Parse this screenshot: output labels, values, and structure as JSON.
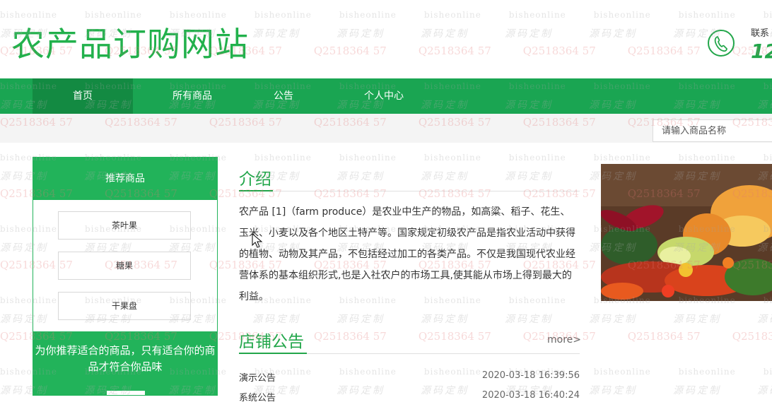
{
  "header": {
    "site_title": "农产品订购网站",
    "contact_label": "联系",
    "contact_number": "12"
  },
  "nav": {
    "items": [
      {
        "label": "首页",
        "active": true
      },
      {
        "label": "所有商品",
        "active": false
      },
      {
        "label": "公告",
        "active": false
      },
      {
        "label": "个人中心",
        "active": false
      }
    ]
  },
  "search": {
    "placeholder": "请输入商品名称"
  },
  "sidebar": {
    "title": "推荐商品",
    "items": [
      "茶叶果",
      "糖果",
      "干果盘"
    ],
    "footer_text": "为你推荐适合的商品，只有适合你的商品才符合你品味"
  },
  "intro": {
    "title": "介绍",
    "text": "农产品 [1]（farm produce）是农业中生产的物品，如高粱、稻子、花生、玉米、小麦以及各个地区土特产等。国家规定初级农产品是指农业活动中获得的植物、动物及其产品，不包括经过加工的各类产品。不仅是我国现代农业经营体系的基本组织形式,也是入社农户的市场工具,使其能从市场上得到最大的利益。"
  },
  "notices": {
    "title": "店铺公告",
    "more": "more>",
    "items": [
      {
        "title": "演示公告",
        "date": "2020-03-18 16:39:56"
      },
      {
        "title": "系统公告",
        "date": "2020-03-18 16:40:24"
      }
    ]
  },
  "watermark": {
    "line1": "bisheonline",
    "line2": "源码定制",
    "line3": "Q2518364 57"
  },
  "colors": {
    "brand": "#22b14c",
    "nav": "#1aa552",
    "nav_active": "#138a42"
  }
}
